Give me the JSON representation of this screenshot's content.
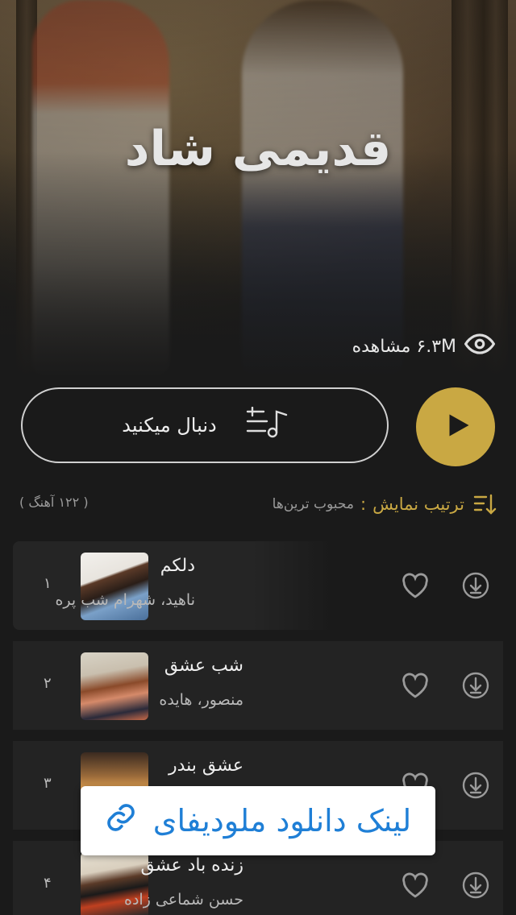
{
  "playlist": {
    "title": "قدیمی شاد",
    "views": "۶.۳M مشاهده"
  },
  "actions": {
    "follow_label": "دنبال میکنید"
  },
  "sort": {
    "label": "ترتیب نمایش",
    "colon": ":",
    "value": "محبوب ترین‌ها",
    "count": "( ۱۲۲ آهنگ )"
  },
  "tracks": [
    {
      "num": "۱",
      "title": "دلکم",
      "artist": "ناهید، شهرام شب پره"
    },
    {
      "num": "۲",
      "title": "شب عشق",
      "artist": "منصور، هایده"
    },
    {
      "num": "۳",
      "title": "عشق بندر",
      "artist": ""
    },
    {
      "num": "۴",
      "title": "زنده باد عشق",
      "artist": "حسن شماعی زاده"
    }
  ],
  "overlay": {
    "text": "لینک دانلود ملودیفای"
  },
  "colors": {
    "accent": "#c9a843",
    "background": "#1a1a1a",
    "link": "#1f7fd6"
  }
}
